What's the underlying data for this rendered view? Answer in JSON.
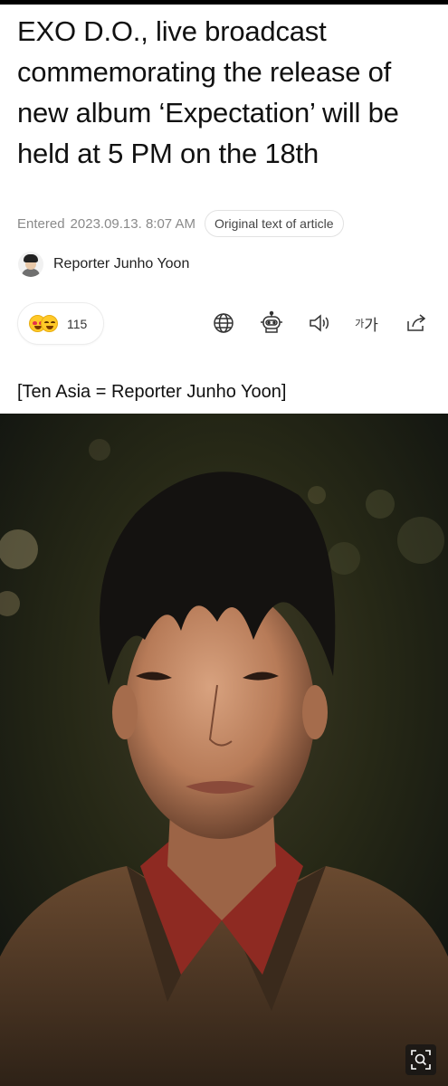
{
  "article": {
    "title": "EXO D.O., live broadcast commemorating the release of new album ‘Expectation’ will be held at 5 PM on the 18th",
    "entered_label": "Entered",
    "entered_date": "2023.09.13. 8:07 AM",
    "original_text_button": "Original text of article",
    "reporter": "Reporter Junho Yoon",
    "caption": "[Ten Asia = Reporter Junho Yoon]"
  },
  "reactions": {
    "count": "115",
    "emojis": [
      "heart-eyes-emoji-icon",
      "laughing-emoji-icon"
    ]
  },
  "toolbar": {
    "icons": [
      "globe-icon",
      "robot-icon",
      "speaker-icon",
      "font-size-icon",
      "share-icon"
    ],
    "font_size_small": "가",
    "font_size_big": "가"
  },
  "photo": {
    "zoom_icon": "zoom-icon"
  },
  "colors": {
    "text_primary": "#111111",
    "text_muted": "#8a8a8a",
    "border": "#e2e2e2"
  }
}
